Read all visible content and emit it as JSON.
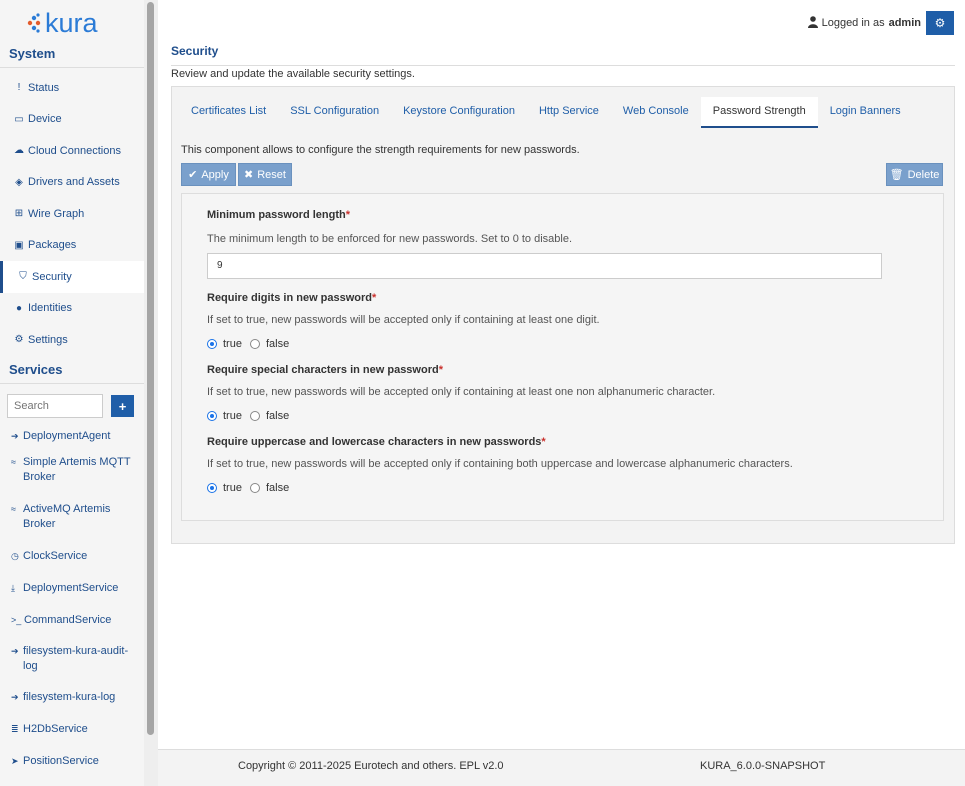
{
  "brand": {
    "name": "kura"
  },
  "header": {
    "logged_in_prefix": "Logged in as",
    "username": "admin"
  },
  "sidebar": {
    "system_title": "System",
    "items": [
      {
        "label": "Status",
        "icon": "exclamation-icon"
      },
      {
        "label": "Device",
        "icon": "hdd-icon"
      },
      {
        "label": "Cloud Connections",
        "icon": "cloud-icon"
      },
      {
        "label": "Drivers and Assets",
        "icon": "cube-icon"
      },
      {
        "label": "Wire Graph",
        "icon": "sitemap-icon"
      },
      {
        "label": "Packages",
        "icon": "briefcase-icon"
      },
      {
        "label": "Security",
        "icon": "shield-icon",
        "active": true
      },
      {
        "label": "Identities",
        "icon": "user-icon"
      },
      {
        "label": "Settings",
        "icon": "gear-icon"
      }
    ],
    "services_title": "Services",
    "search_placeholder": "Search",
    "add_label": "+",
    "services": [
      {
        "label": "DeploymentAgent",
        "icon": "circle-arrow-icon"
      },
      {
        "label": "Simple Artemis MQTT Broker",
        "icon": "rss-icon"
      },
      {
        "label": "ActiveMQ Artemis Broker",
        "icon": "rss-icon"
      },
      {
        "label": "ClockService",
        "icon": "clock-icon"
      },
      {
        "label": "DeploymentService",
        "icon": "download-icon"
      },
      {
        "label": "CommandService",
        "icon": "terminal-icon"
      },
      {
        "label": "filesystem-kura-audit-log",
        "icon": "circle-arrow-icon"
      },
      {
        "label": "filesystem-kura-log",
        "icon": "circle-arrow-icon"
      },
      {
        "label": "H2DbService",
        "icon": "database-icon"
      },
      {
        "label": "PositionService",
        "icon": "location-arrow-icon"
      }
    ]
  },
  "page": {
    "title": "Security",
    "subtitle": "Review and update the available security settings."
  },
  "tabs": [
    {
      "label": "Certificates List"
    },
    {
      "label": "SSL Configuration"
    },
    {
      "label": "Keystore Configuration"
    },
    {
      "label": "Http Service"
    },
    {
      "label": "Web Console"
    },
    {
      "label": "Password Strength",
      "active": true
    },
    {
      "label": "Login Banners"
    }
  ],
  "content": {
    "intro": "This component allows to configure the strength requirements for new passwords.",
    "apply_label": "Apply",
    "reset_label": "Reset",
    "delete_label": "Delete",
    "fields": {
      "min_length": {
        "label": "Minimum password length",
        "required_mark": "*",
        "description": "The minimum length to be enforced for new passwords. Set to 0 to disable.",
        "value": "9"
      },
      "digits": {
        "label": "Require digits in new password",
        "required_mark": "*",
        "description": "If set to true, new passwords will be accepted only if containing at least one digit.",
        "true_label": "true",
        "false_label": "false",
        "selected": "true"
      },
      "special": {
        "label": "Require special characters in new password",
        "required_mark": "*",
        "description": "If set to true, new passwords will be accepted only if containing at least one non alphanumeric character.",
        "true_label": "true",
        "false_label": "false",
        "selected": "true"
      },
      "case": {
        "label": "Require uppercase and lowercase characters in new passwords",
        "required_mark": "*",
        "description": "If set to true, new passwords will be accepted only if containing both uppercase and lowercase alphanumeric characters.",
        "true_label": "true",
        "false_label": "false",
        "selected": "true"
      }
    }
  },
  "footer": {
    "copyright": "Copyright © 2011-2025 Eurotech and others. EPL v2.0",
    "version": "KURA_6.0.0-SNAPSHOT"
  },
  "colors": {
    "brand_blue": "#1f5ea8",
    "nav_text": "#1f4e8c",
    "required": "#c9302c"
  }
}
